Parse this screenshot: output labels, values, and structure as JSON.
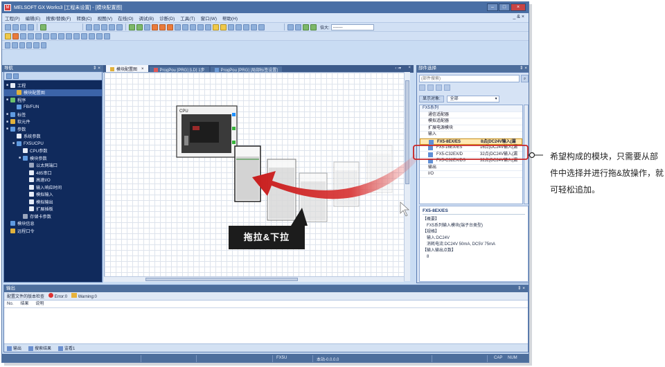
{
  "window": {
    "title": "MELSOFT GX Works3 [工程未设置] - [模块配置图]",
    "app_icon": "app-icon"
  },
  "menu": {
    "items": [
      "工程(P)",
      "编辑(E)",
      "搜索/替换(F)",
      "转换(C)",
      "视图(V)",
      "在线(O)",
      "调试(B)",
      "诊断(D)",
      "工具(T)",
      "窗口(W)",
      "帮助(H)"
    ],
    "right": "_ & ×"
  },
  "toolbar": {
    "zoom_label": "倍大:",
    "zoom_value": "-------"
  },
  "navigation": {
    "title": "导航",
    "pin": "⇕ ×",
    "items": [
      {
        "label": "工程",
        "level": 0,
        "expanded": true,
        "icon": "project-icon",
        "color": "white"
      },
      {
        "label": "模块配置图",
        "level": 1,
        "icon": "module-config-icon",
        "color": "gold",
        "selected": true
      },
      {
        "label": "程序",
        "level": 0,
        "expanded": true,
        "icon": "program-icon",
        "color": "green"
      },
      {
        "label": "FB/FUN",
        "level": 1,
        "icon": "fb-icon",
        "color": "blue"
      },
      {
        "label": "标签",
        "level": 0,
        "expanded": true,
        "icon": "label-icon",
        "color": "blue"
      },
      {
        "label": "软元件",
        "level": 0,
        "expanded": true,
        "icon": "device-icon",
        "color": "gold"
      },
      {
        "label": "参数",
        "level": 0,
        "expanded": true,
        "icon": "parameter-icon",
        "color": "blue"
      },
      {
        "label": "系统参数",
        "level": 1,
        "icon": "system-param-icon",
        "color": "white"
      },
      {
        "label": "FX5UCPU",
        "level": 1,
        "expanded": true,
        "icon": "cpu-icon",
        "color": "blue"
      },
      {
        "label": "CPU参数",
        "level": 2,
        "icon": "cpu-param-icon",
        "color": "white"
      },
      {
        "label": "模块参数",
        "level": 2,
        "expanded": true,
        "icon": "module-param-icon",
        "color": "blue"
      },
      {
        "label": "以太网端口",
        "level": 3,
        "icon": "ethernet-icon",
        "color": "gray"
      },
      {
        "label": "485串口",
        "level": 3,
        "icon": "serial-icon",
        "color": "white"
      },
      {
        "label": "高速I/O",
        "level": 3,
        "icon": "hsio-icon",
        "color": "white"
      },
      {
        "label": "输入响应时间",
        "level": 3,
        "icon": "input-response-icon",
        "color": "white"
      },
      {
        "label": "模拟输入",
        "level": 3,
        "icon": "analog-input-icon",
        "color": "white"
      },
      {
        "label": "模拟输出",
        "level": 3,
        "icon": "analog-output-icon",
        "color": "white"
      },
      {
        "label": "扩展插板",
        "level": 3,
        "icon": "expansion-board-icon",
        "color": "white"
      },
      {
        "label": "存储卡参数",
        "level": 2,
        "icon": "memory-card-icon",
        "color": "gray"
      },
      {
        "label": "模块信息",
        "level": 0,
        "icon": "module-info-icon",
        "color": "blue"
      },
      {
        "label": "远程口令",
        "level": 0,
        "icon": "remote-password-icon",
        "color": "gold"
      }
    ]
  },
  "tabs": [
    {
      "label": "ProgPou [PRG] [局部标签设置]",
      "icon": "table-icon",
      "active": false
    },
    {
      "label": "ProgPou [PRG] [LD] 1步",
      "icon": "ladder-icon",
      "active": false
    },
    {
      "label": "模块配置图",
      "icon": "config-icon",
      "active": true
    }
  ],
  "canvas": {
    "cpu_label": "CPU",
    "callout": "拖拉&下拉"
  },
  "parts": {
    "title": "部件选择",
    "search_placeholder": "(部件搜索)",
    "filter_label": "显示对象:",
    "filter_value": "全部",
    "list": [
      {
        "label": "FX5系列",
        "type": "cat"
      },
      {
        "label": "通信适配器",
        "type": "sub"
      },
      {
        "label": "模拟适配器",
        "type": "sub"
      },
      {
        "label": "扩展电源模块",
        "type": "sub"
      },
      {
        "label": "输入",
        "type": "sub"
      },
      {
        "label": "FX5-8EX/ES",
        "spec": "8点(DC24V输入(漏",
        "type": "item",
        "selected": true
      },
      {
        "label": "FX5-16EX/ES",
        "spec": "16点(DC24V输入(漏",
        "type": "item"
      },
      {
        "label": "FX5-C32EX/D",
        "spec": "32点(DC24V输入(漏",
        "type": "item"
      },
      {
        "label": "FX5-C32EX/DS",
        "spec": "32点(DC24V输入(漏",
        "type": "item"
      },
      {
        "label": "输出",
        "type": "sub"
      },
      {
        "label": "I/O",
        "type": "sub"
      }
    ],
    "desc": {
      "heading": "FX5-8EX/ES",
      "lines": [
        "【概要】",
        "FX5系列输入模块(端子台类型)",
        "【规格】",
        "输入:DC24V",
        "消耗电流:DC24V 50mA, DC5V 75mA",
        "【输入输出点数】",
        "8"
      ]
    }
  },
  "output": {
    "title": "输出",
    "check_label": "配置文件的版本检查",
    "error_label": "Error:0",
    "warning_label": "Warning:0",
    "cols": [
      "No.",
      "结果",
      "说明"
    ],
    "bottom_tabs": [
      "输出",
      "搜索结果",
      "监看1"
    ]
  },
  "status": {
    "cpu": "FX5U",
    "station": "本站-0.0.0.0",
    "caps": "CAP",
    "num": "NUM"
  },
  "annotation": {
    "text": "希望构成的模块，只需要从部件中选择并进行拖&放操作，就可轻松追加。"
  },
  "colors": {
    "accent": "#d42a2a",
    "title_bar": "#4a6fa5",
    "nav_bg": "#102a5c",
    "selection": "#ffe9b3"
  }
}
